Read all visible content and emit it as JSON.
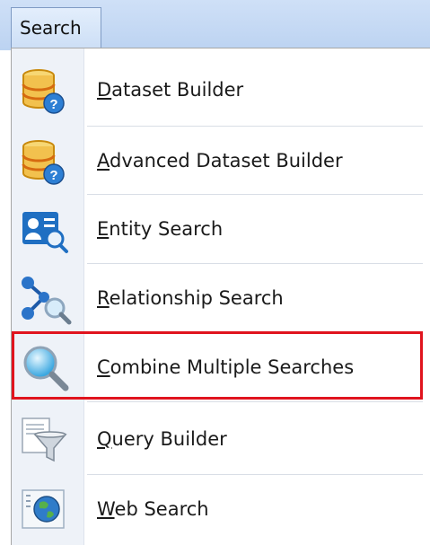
{
  "menu": {
    "title": "Search"
  },
  "items": [
    {
      "label": "Dataset Builder",
      "accel": "D",
      "rest": "ataset Builder",
      "icon": "database-question-icon"
    },
    {
      "label": "Advanced Dataset Builder",
      "accel": "A",
      "rest": "dvanced Dataset Builder",
      "icon": "database-question-icon"
    },
    {
      "label": "Entity Search",
      "accel": "E",
      "rest": "ntity Search",
      "icon": "entity-search-icon"
    },
    {
      "label": "Relationship Search",
      "accel": "R",
      "rest": "elationship Search",
      "icon": "relationship-search-icon"
    },
    {
      "label": "Combine Multiple Searches",
      "accel": "C",
      "rest": "ombine Multiple Searches",
      "icon": "magnifier-icon"
    },
    {
      "label": "Query Builder",
      "accel": "Q",
      "rest": "uery Builder",
      "icon": "funnel-document-icon"
    },
    {
      "label": "Web Search",
      "accel": "W",
      "rest": "eb Search",
      "icon": "globe-page-icon"
    }
  ],
  "highlighted_item": "Combine Multiple Searches",
  "colors": {
    "highlight": "#e0141e",
    "menubar": "#c6daf4"
  }
}
